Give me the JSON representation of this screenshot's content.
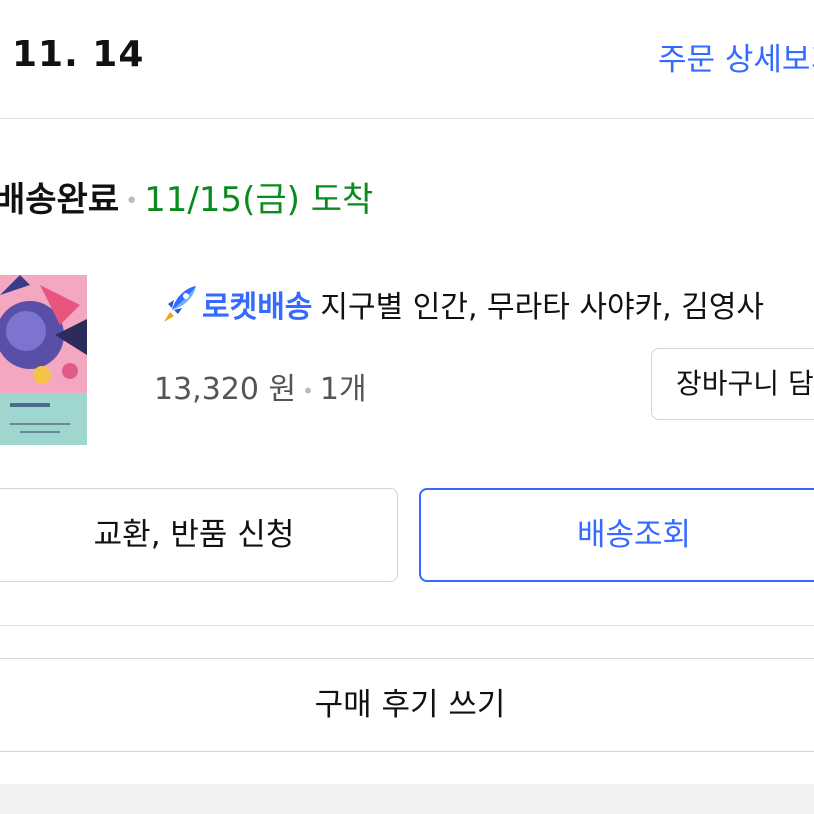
{
  "header": {
    "order_date": "11. 14",
    "order_detail_link": "주문 상세보기"
  },
  "shipment": {
    "status": "배송완료",
    "arrival": "11/15(금) 도착"
  },
  "product": {
    "thumbnail_icon": "book-cover-thumbnail",
    "delivery_badge": "로켓배송",
    "delivery_icon": "rocket-icon",
    "title": "지구별 인간, 무라타 사야카, 김영사",
    "price": "13,320 원",
    "quantity": "1개",
    "cart_button": "장바구니 담기"
  },
  "actions": {
    "exchange_return": "교환, 반품 신청",
    "track_delivery": "배송조회",
    "write_review": "구매 후기 쓰기"
  },
  "colors": {
    "accent_blue": "#346aff",
    "arrival_green": "#0a8a1f",
    "border": "#d4d4d4"
  }
}
